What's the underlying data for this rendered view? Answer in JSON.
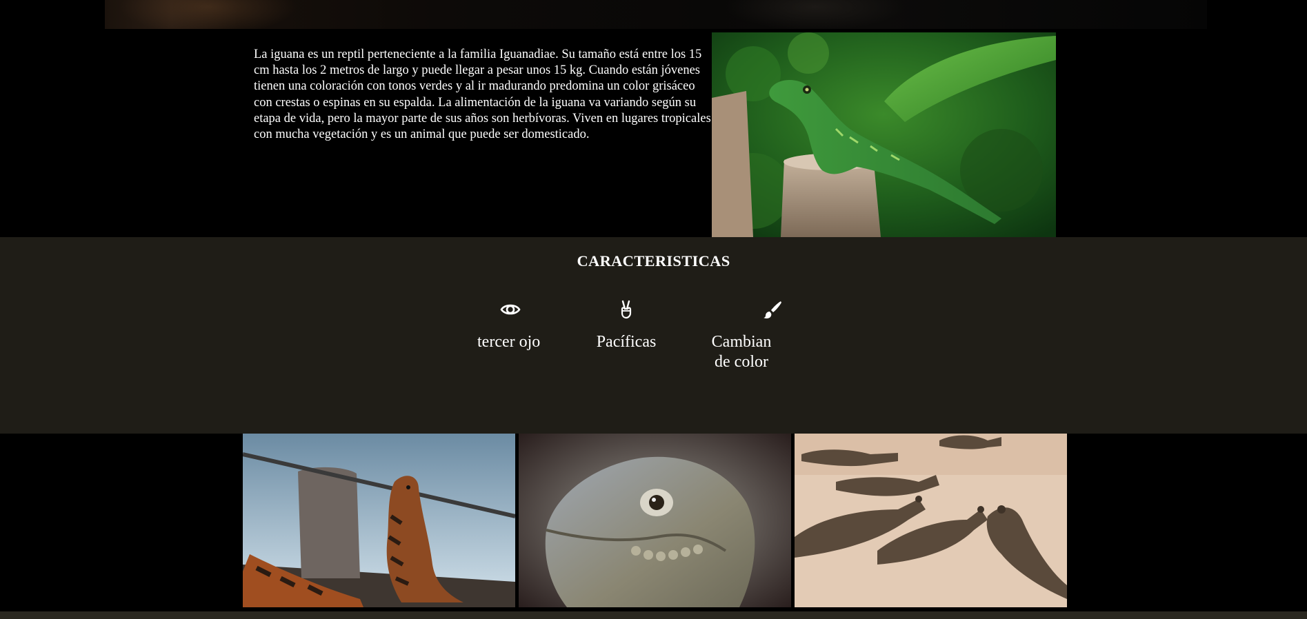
{
  "intro": {
    "paragraph": "La iguana es un reptil perteneciente a la familia Iguanadiae. Su tamaño está entre los 15 cm hasta los 2 metros de largo y puede llegar a pesar unos 15 kg. Cuando están jóvenes tienen una coloración con tonos verdes y al ir madurando predomina un color grisáceo con crestas o espinas en su espalda. La alimentación de la iguana va variando según su etapa de vida, pero la mayor parte de sus años son herbívoras. Viven en lugares tropicales con mucha vegetación y es un animal que puede ser domesticado."
  },
  "features": {
    "title": "CARACTERISTICAS",
    "items": [
      {
        "icon": "eye-icon",
        "label": "tercer ojo"
      },
      {
        "icon": "peace-hand-icon",
        "label": "Pacíficas"
      },
      {
        "icon": "paint-brush-icon",
        "label": "Cambian de color"
      }
    ]
  },
  "colors": {
    "page_background": "#000000",
    "features_background": "#1f1d17",
    "text": "#ffffff",
    "bottom_bar": "#2a2820"
  }
}
